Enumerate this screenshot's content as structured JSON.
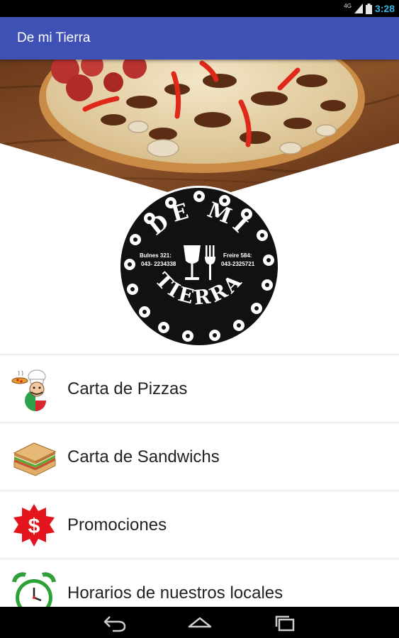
{
  "status_bar": {
    "network": "4G",
    "time": "3:28",
    "time_color": "#33b5e5"
  },
  "app_bar": {
    "title": "De mi Tierra",
    "color": "#3f51b5"
  },
  "logo": {
    "arc_top": "DE MI",
    "arc_bottom": "TIERRA",
    "left_address": "Bulnes 321:",
    "left_phone": "043- 2234338",
    "right_address": "Freire 584:",
    "right_phone": "043-2325721"
  },
  "menu": {
    "items": [
      {
        "label": "Carta de Pizzas",
        "icon": "pizza-chef-icon"
      },
      {
        "label": "Carta de Sandwichs",
        "icon": "sandwich-icon"
      },
      {
        "label": "Promociones",
        "icon": "dollar-badge-icon"
      },
      {
        "label": "Horarios de nuestros locales",
        "icon": "alarm-clock-icon"
      }
    ]
  },
  "nav_bar": {
    "buttons": [
      "back-icon",
      "home-icon",
      "recents-icon"
    ]
  }
}
